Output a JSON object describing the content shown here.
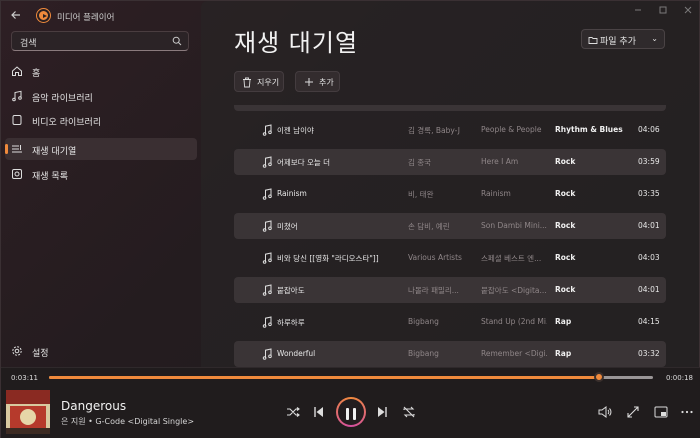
{
  "app": {
    "title": "미디어 플레이어"
  },
  "search": {
    "placeholder": "검색"
  },
  "sidebar": {
    "items": [
      {
        "label": "홈",
        "icon": "home-icon"
      },
      {
        "label": "음악 라이브러리",
        "icon": "music-note-icon"
      },
      {
        "label": "비디오 라이브러리",
        "icon": "video-icon"
      },
      {
        "label": "재생 대기열",
        "icon": "queue-icon",
        "active": true
      },
      {
        "label": "재생 목록",
        "icon": "playlist-icon"
      }
    ],
    "settings_label": "설정"
  },
  "main": {
    "title": "재생 대기열",
    "add_file_label": "파일 추가",
    "clear_label": "지우기",
    "add_label": "추가"
  },
  "queue": [
    {
      "title": "이젠 남이야",
      "artist": "김 경록, Baby-J",
      "album": "People & People",
      "genre": "Rhythm & Blues",
      "duration": "04:06",
      "alt": false
    },
    {
      "title": "어제보다 오늘 더",
      "artist": "김 종국",
      "album": "Here I Am",
      "genre": "Rock",
      "duration": "03:59",
      "alt": true
    },
    {
      "title": "Rainism",
      "artist": "비, 태완",
      "album": "Rainism",
      "genre": "Rock",
      "duration": "03:35",
      "alt": false
    },
    {
      "title": "미쳤어",
      "artist": "손 담비, 예린",
      "album": "Son Dambi Mini...",
      "genre": "Rock",
      "duration": "04:01",
      "alt": true
    },
    {
      "title": "비와 당신 [[영화 \"라디오스타\"]]",
      "artist": "Various Artists",
      "album": "스페셜 베스트 엔...",
      "genre": "Rock",
      "duration": "04:03",
      "alt": false
    },
    {
      "title": "붙잡아도",
      "artist": "나몰라 패밀리...",
      "album": "붙잡아도 <Digita...",
      "genre": "Rock",
      "duration": "04:01",
      "alt": true
    },
    {
      "title": "하루하루",
      "artist": "Bigbang",
      "album": "Stand Up (2nd Mi...",
      "genre": "Rap",
      "duration": "04:15",
      "alt": false
    },
    {
      "title": "Wonderful",
      "artist": "Bigbang",
      "album": "Remember <Digi...",
      "genre": "Rap",
      "duration": "03:32",
      "alt": true
    }
  ],
  "player": {
    "elapsed": "0:03:11",
    "remaining": "0:00:18",
    "progress": 0.91,
    "title": "Dangerous",
    "subtitle": "은 지원 • G-Code <Digital Single>"
  },
  "colors": {
    "accent": "#f08a3c",
    "accent2": "#d44fa0"
  }
}
